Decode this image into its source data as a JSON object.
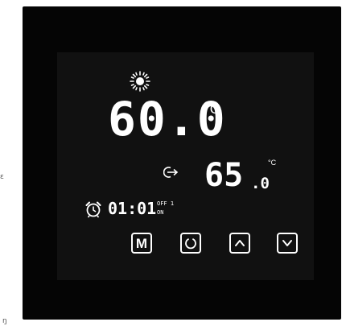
{
  "display": {
    "main_temperature": "60.0",
    "main_unit": "°C",
    "set_temperature": "65",
    "set_decimal": ".0",
    "set_unit": "°C",
    "clock_time": "01:01",
    "timer_off_label": "OFF 1",
    "timer_on_label": "ON"
  },
  "buttons": {
    "mode_label": "M"
  },
  "page_margin": {
    "left_char": "ε",
    "bottom_char": "ŋ"
  },
  "icons": {
    "status": "sun-icon",
    "set_indicator": "arrow-in-icon",
    "clock": "alarm-clock-icon",
    "power": "power-icon",
    "up": "chevron-up-icon",
    "down": "chevron-down-icon"
  },
  "colors": {
    "bezel": "#050505",
    "screen": "#111111",
    "foreground": "#ffffff"
  }
}
